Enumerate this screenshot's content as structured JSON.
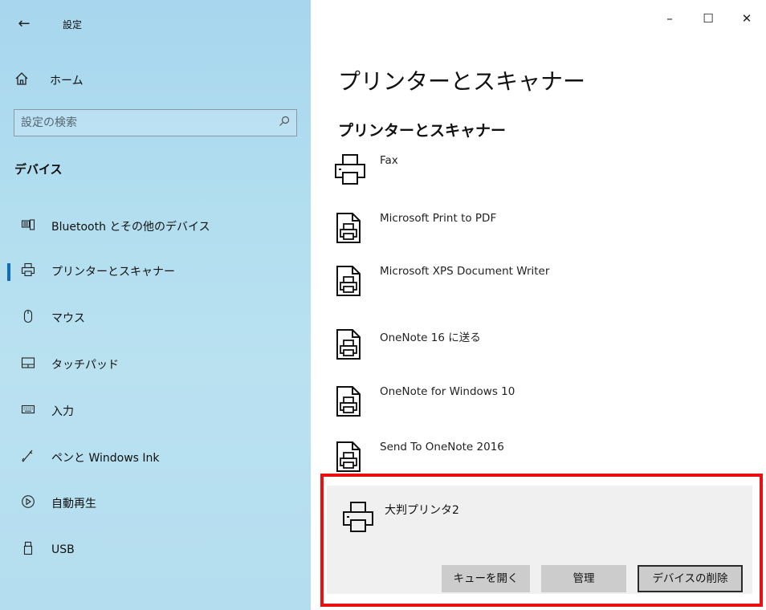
{
  "window": {
    "title": "設定",
    "controls": {
      "minimize": "–",
      "maximize": "☐",
      "close": "✕"
    }
  },
  "sidebar": {
    "home_label": "ホーム",
    "search": {
      "placeholder": "設定の検索",
      "value": ""
    },
    "section_heading": "デバイス",
    "items": [
      {
        "label": "Bluetooth とその他のデバイス",
        "icon": "bluetooth-devices-icon",
        "selected": false
      },
      {
        "label": "プリンターとスキャナー",
        "icon": "printer-icon",
        "selected": true
      },
      {
        "label": "マウス",
        "icon": "mouse-icon",
        "selected": false
      },
      {
        "label": "タッチパッド",
        "icon": "touchpad-icon",
        "selected": false
      },
      {
        "label": "入力",
        "icon": "keyboard-icon",
        "selected": false
      },
      {
        "label": "ペンと Windows Ink",
        "icon": "pen-icon",
        "selected": false
      },
      {
        "label": "自動再生",
        "icon": "autoplay-icon",
        "selected": false
      },
      {
        "label": "USB",
        "icon": "usb-icon",
        "selected": false
      }
    ]
  },
  "main": {
    "page_title": "プリンターとスキャナー",
    "section_title": "プリンターとスキャナー",
    "devices": [
      {
        "name": "Fax",
        "icon": "printer-icon"
      },
      {
        "name": "Microsoft Print to PDF",
        "icon": "document-printer-icon"
      },
      {
        "name": "Microsoft XPS Document Writer",
        "icon": "document-printer-icon"
      },
      {
        "name": "OneNote 16 に送る",
        "icon": "document-printer-icon"
      },
      {
        "name": "OneNote for Windows 10",
        "icon": "document-printer-icon"
      },
      {
        "name": "Send To OneNote 2016",
        "icon": "document-printer-icon"
      }
    ],
    "selected_device": {
      "name": "大判プリンタ2",
      "icon": "printer-icon",
      "buttons": {
        "open_queue": "キューを開く",
        "manage": "管理",
        "remove_device": "デバイスの削除"
      }
    }
  },
  "colors": {
    "accent": "#0f6cbd",
    "highlight": "#e81010",
    "sidebar_bg": "#b2deef",
    "selected_panel_bg": "#f0f0f0",
    "button_bg": "#cccccc"
  }
}
